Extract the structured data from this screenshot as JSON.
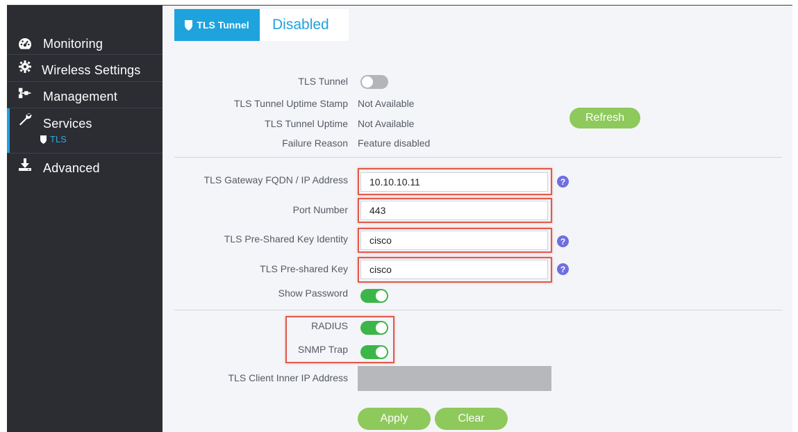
{
  "sidebar": {
    "items": [
      {
        "label": "Monitoring",
        "icon": "dashboard-icon"
      },
      {
        "label": "Wireless Settings",
        "icon": "gear-icon"
      },
      {
        "label": "Management",
        "icon": "network-icon"
      },
      {
        "label": "Services",
        "icon": "wrench-icon"
      },
      {
        "label": "Advanced",
        "icon": "download-icon"
      }
    ],
    "active_sub": {
      "label": "TLS",
      "icon": "shield-icon"
    }
  },
  "header": {
    "badge_label": "TLS Tunnel",
    "status": "Disabled"
  },
  "status_section": {
    "tunnel_label": "TLS Tunnel",
    "tunnel_enabled": false,
    "uptime_stamp_label": "TLS Tunnel Uptime Stamp",
    "uptime_stamp_value": "Not Available",
    "uptime_label": "TLS Tunnel Uptime",
    "uptime_value": "Not Available",
    "failure_label": "Failure Reason",
    "failure_value": "Feature disabled",
    "refresh_label": "Refresh"
  },
  "config": {
    "gateway_label": "TLS Gateway FQDN / IP Address",
    "gateway_value": "10.10.10.11",
    "port_label": "Port Number",
    "port_value": "443",
    "psk_identity_label": "TLS Pre-Shared Key Identity",
    "psk_identity_value": "cisco",
    "psk_label": "TLS Pre-shared Key",
    "psk_value": "cisco",
    "show_password_label": "Show Password",
    "show_password_enabled": true,
    "help_symbol": "?"
  },
  "options": {
    "radius_label": "RADIUS",
    "radius_enabled": true,
    "snmp_label": "SNMP Trap",
    "snmp_enabled": true,
    "inner_ip_label": "TLS Client Inner IP Address",
    "inner_ip_value": ""
  },
  "actions": {
    "apply_label": "Apply",
    "clear_label": "Clear"
  },
  "colors": {
    "sidebar_bg": "#2b2d33",
    "accent": "#1ea3dd",
    "toggle_on": "#3cb649",
    "button_green": "#8ec95c",
    "highlight": "#e05a4a",
    "help_purple": "#6f6fe0"
  }
}
